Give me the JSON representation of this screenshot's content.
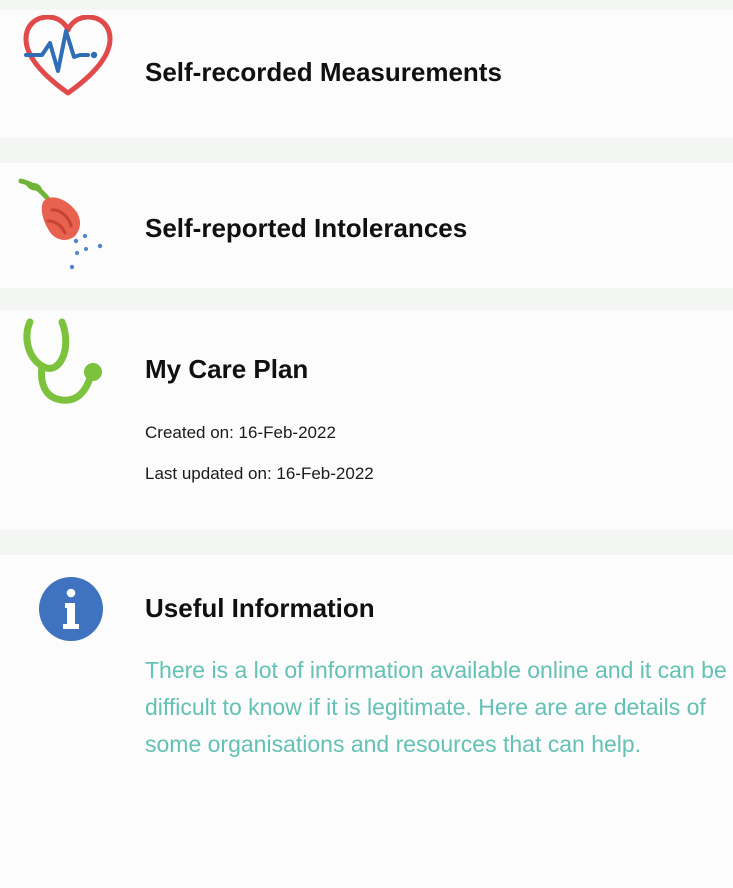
{
  "colors": {
    "heart": "#e04a4a",
    "pulse": "#2f6db6",
    "flower": "#e9624f",
    "stethoscope": "#7cc23d",
    "info": "#3f73bf",
    "teal_text": "#63c1b5"
  },
  "cards": [
    {
      "title": "Self-recorded Measurements",
      "icon": "heart-pulse-icon"
    },
    {
      "title": "Self-reported Intolerances",
      "icon": "flower-pollen-icon"
    },
    {
      "title": "My Care Plan",
      "icon": "stethoscope-icon",
      "created": "Created on: 16-Feb-2022",
      "updated": "Last updated on: 16-Feb-2022"
    },
    {
      "title": "Useful Information",
      "icon": "info-icon",
      "description": "There is a lot of information available online and it can be difficult to know if it is legitimate. Here are are details of some organisations and resources that can help."
    }
  ]
}
